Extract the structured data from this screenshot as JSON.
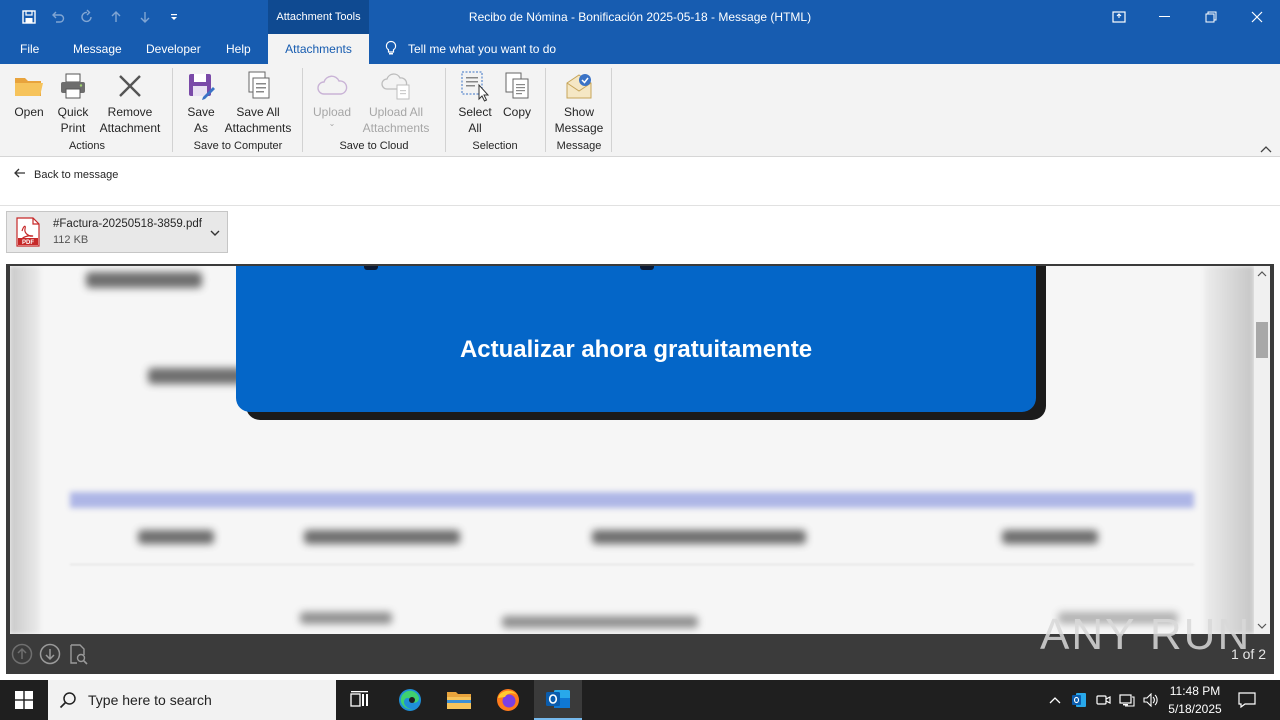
{
  "window": {
    "title": "Recibo de Nómina - Bonificación 2025-05-18  -  Message (HTML)",
    "context_tab_group": "Attachment Tools"
  },
  "quick_access": {
    "icons": [
      "save-icon",
      "undo-icon",
      "redo-icon",
      "up-arrow-icon",
      "down-arrow-icon",
      "customize-icon"
    ]
  },
  "tabs": [
    {
      "label": "File"
    },
    {
      "label": "Message"
    },
    {
      "label": "Developer"
    },
    {
      "label": "Help"
    },
    {
      "label": "Attachments"
    }
  ],
  "tell_me": "Tell me what you want to do",
  "ribbon": {
    "groups": {
      "actions": "Actions",
      "save_to_computer": "Save to Computer",
      "save_to_cloud": "Save to Cloud",
      "selection": "Selection",
      "message": "Message"
    },
    "buttons": {
      "open": "Open",
      "quick_print_1": "Quick",
      "quick_print_2": "Print",
      "remove_1": "Remove",
      "remove_2": "Attachment",
      "save_as_1": "Save",
      "save_as_2": "As",
      "save_all_1": "Save All",
      "save_all_2": "Attachments",
      "upload": "Upload",
      "upload_all_1": "Upload All",
      "upload_all_2": "Attachments",
      "select_all_1": "Select",
      "select_all_2": "All",
      "copy": "Copy",
      "show_message_1": "Show",
      "show_message_2": "Message"
    }
  },
  "back_link": "Back to message",
  "attachment": {
    "file_name": "#Factura-20250518-3859.pdf",
    "file_size": "112 KB"
  },
  "preview": {
    "cta_text": "Actualizar ahora gratuitamente",
    "page_indicator": "1 of 2",
    "watermark": "ANY RUN"
  },
  "taskbar": {
    "search_placeholder": "Type here to search",
    "time": "11:48 PM",
    "date": "5/18/2025"
  },
  "colors": {
    "title_bar": "#175cb0",
    "ribbon": "#f3f3f3",
    "cta_blue": "#0466c8",
    "taskbar": "#1f1f1f"
  }
}
